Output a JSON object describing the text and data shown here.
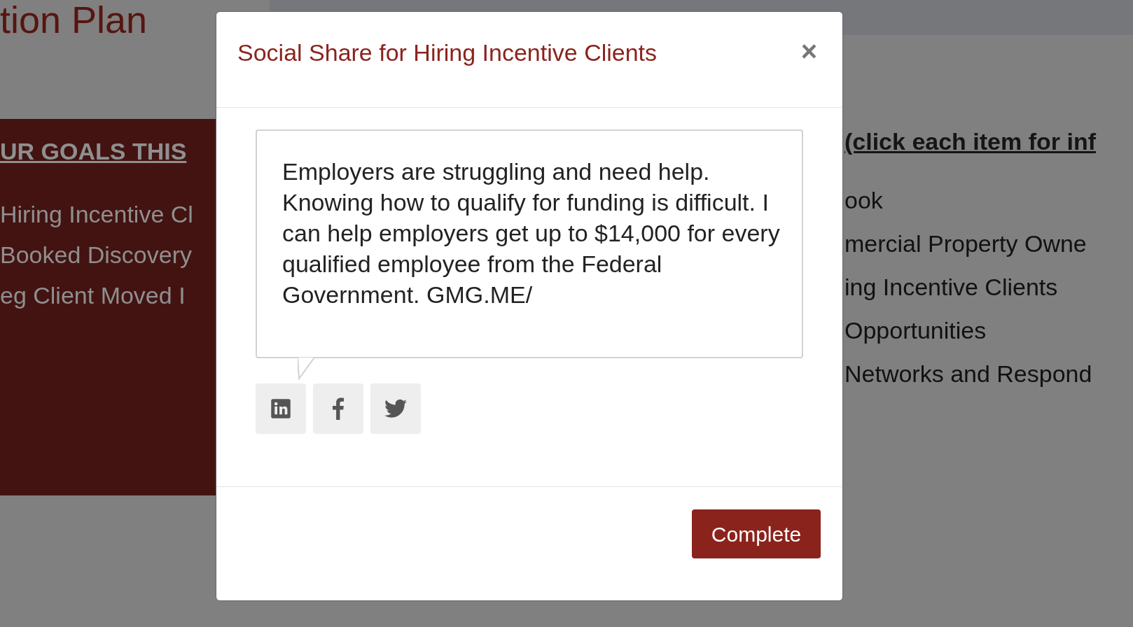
{
  "page_title": "tion Plan",
  "goals_panel": {
    "heading": "UR GOALS THIS",
    "items": [
      "Hiring Incentive Cl",
      "Booked Discovery",
      "eg Client Moved I"
    ]
  },
  "checklist": {
    "heading": "(click each item for inf",
    "items": [
      "ook",
      "mercial Property Owne",
      "ing Incentive Clients",
      "Opportunities",
      "Networks and Respond"
    ]
  },
  "modal": {
    "title": "Social Share for Hiring Incentive Clients",
    "close": "×",
    "message": "Employers are struggling and need help. Knowing how to qualify for funding is difficult. I can help employers get up to $14,000 for every qualified employee from the Federal Government. GMG.ME/",
    "share_buttons": [
      {
        "kind": "linkedin"
      },
      {
        "kind": "facebook"
      },
      {
        "kind": "twitter"
      }
    ],
    "primary_button": "Complete"
  }
}
